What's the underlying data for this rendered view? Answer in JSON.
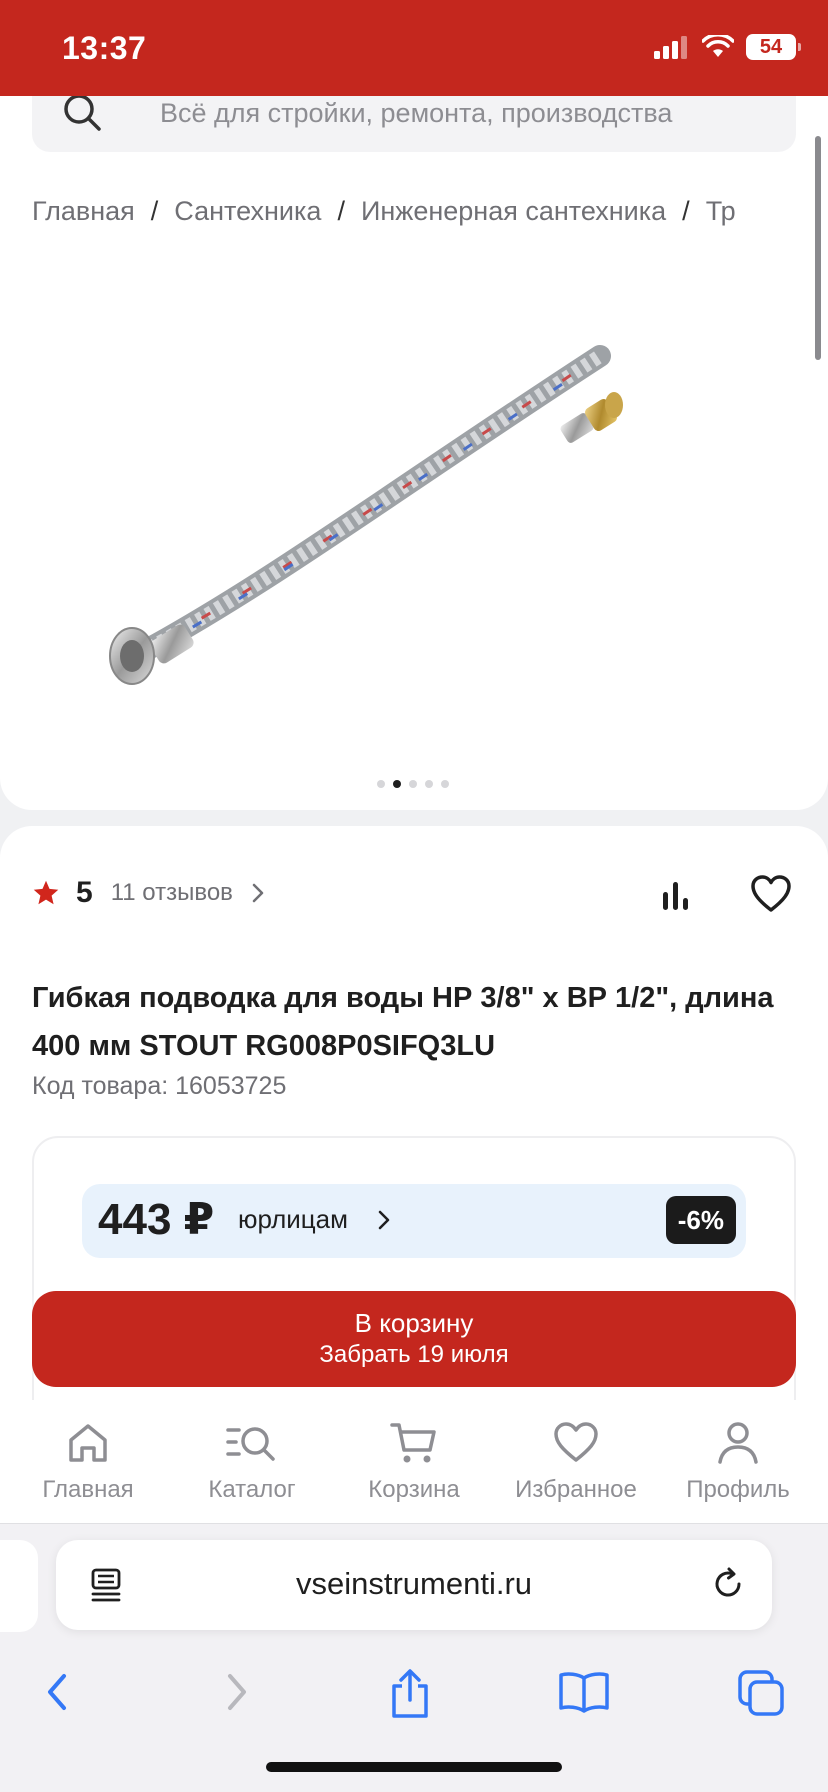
{
  "status": {
    "time": "13:37",
    "battery": "54"
  },
  "search": {
    "placeholder": "Всё для стройки, ремонта, производства"
  },
  "breadcrumb": [
    "Главная",
    "Сантехника",
    "Инженерная сантехника",
    "Тр"
  ],
  "gallery": {
    "total": 5,
    "active": 1
  },
  "rating": {
    "value": "5",
    "reviews": "11 отзывов"
  },
  "product": {
    "title": "Гибкая подводка для воды НР 3/8\" х ВР 1/2\", длина 400 мм STOUT RG008P0SIFQ3LU",
    "code": "Код товара: 16053725"
  },
  "price": {
    "value": "443 ₽",
    "legal_label": "юрлицам",
    "discount": "-6%"
  },
  "cart_button": {
    "line1": "В корзину",
    "line2": "Забрать 19 июля"
  },
  "tabs": [
    {
      "label": "Главная",
      "icon": "home-icon"
    },
    {
      "label": "Каталог",
      "icon": "catalog-search-icon"
    },
    {
      "label": "Корзина",
      "icon": "cart-icon"
    },
    {
      "label": "Избранное",
      "icon": "heart-icon"
    },
    {
      "label": "Профиль",
      "icon": "profile-icon"
    }
  ],
  "browser": {
    "url": "vseinstrumenti.ru"
  },
  "colors": {
    "brand_red": "#c4271e",
    "price_bg": "#e8f2fc",
    "ios_blue": "#3478f6"
  }
}
